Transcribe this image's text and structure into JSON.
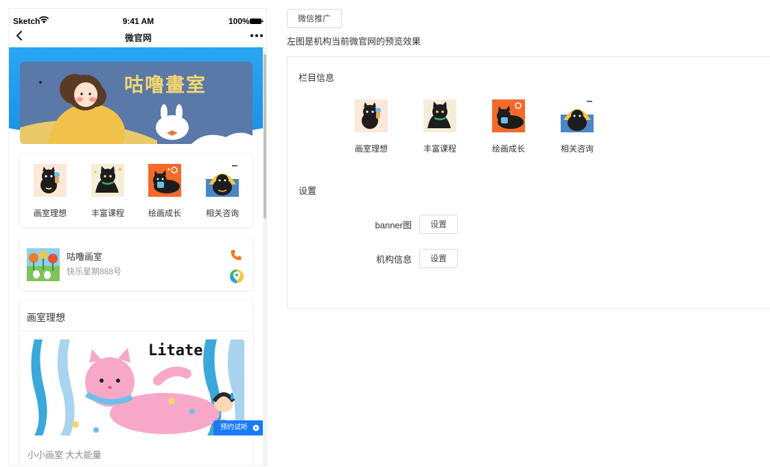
{
  "phone": {
    "status": {
      "carrier": "Sketch",
      "time": "9:41 AM",
      "battery": "100%"
    },
    "nav_title": "微官网",
    "banner_text": "咕噜畫室",
    "menu": [
      {
        "label": "画室理想",
        "icon": "black-cat-ice-cream-icon"
      },
      {
        "label": "丰富课程",
        "icon": "black-cat-sitting-icon"
      },
      {
        "label": "绘画成长",
        "icon": "black-cat-lying-icon"
      },
      {
        "label": "相关咨询",
        "icon": "black-cat-hat-icon"
      }
    ],
    "org": {
      "name": "咕噜画室",
      "address": "快乐星期888号"
    },
    "section": {
      "title": "画室理想",
      "image_text": "Litate",
      "trial_badge": "预约试听",
      "subtitle": "小小画室 大大能量"
    }
  },
  "admin": {
    "tab_label": "微信推广",
    "description": "左图是机构当前微官网的预览效果",
    "column_heading": "栏目信息",
    "columns": [
      {
        "label": "画室理想"
      },
      {
        "label": "丰富课程"
      },
      {
        "label": "绘画成长"
      },
      {
        "label": "相关咨询"
      }
    ],
    "settings_heading": "设置",
    "settings": [
      {
        "label": "banner图",
        "button": "设置"
      },
      {
        "label": "机构信息",
        "button": "设置"
      }
    ]
  },
  "colors": {
    "accent_blue": "#1a9ff0",
    "banner_bg": "#5a78a8",
    "banner_title": "#f5d76e"
  }
}
